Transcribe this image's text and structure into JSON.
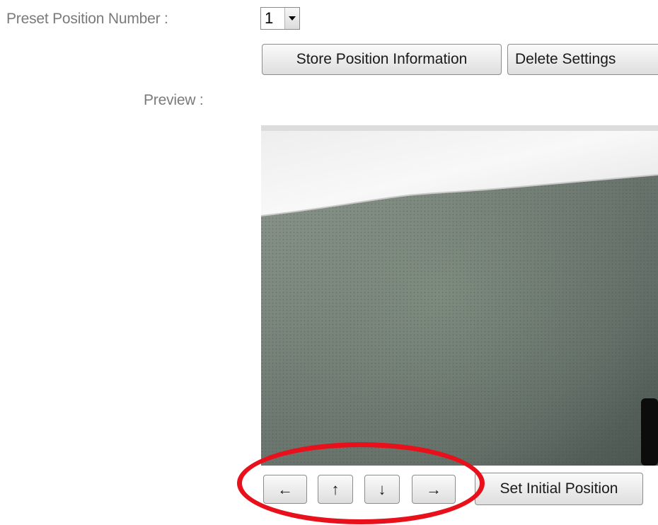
{
  "form": {
    "preset_label": "Preset Position Number :",
    "preset_value": "1",
    "store_button": "Store Position Information",
    "delete_button": "Delete Settings",
    "preview_label": "Preview :"
  },
  "controls": {
    "left": "←",
    "up": "↑",
    "down": "↓",
    "right": "→",
    "set_initial": "Set Initial Position"
  },
  "colors": {
    "highlight": "#e8101a",
    "label_text": "#7a7a7a"
  },
  "icons": {
    "select_arrow": "chevron-down-icon",
    "highlight": "red-ellipse-annotation"
  }
}
